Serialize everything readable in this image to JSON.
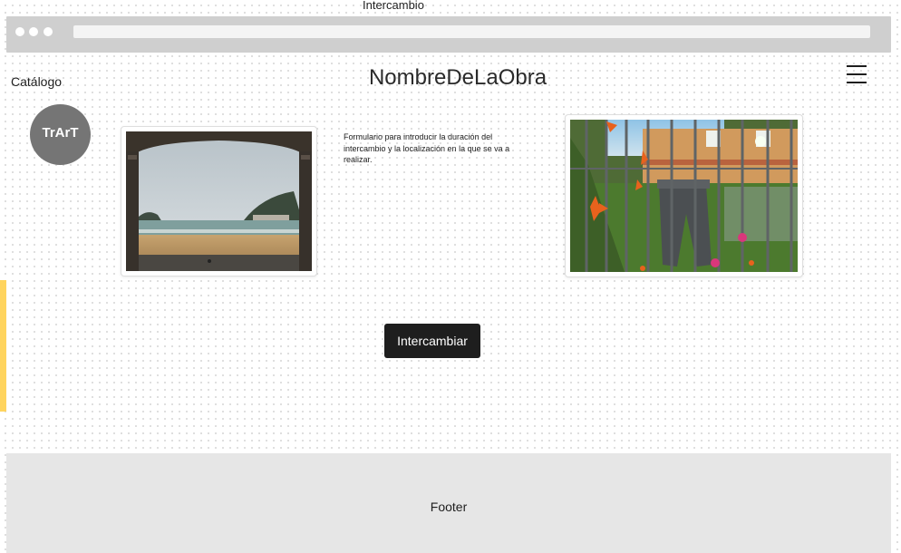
{
  "frame": {
    "title": "Intercambio"
  },
  "browser": {
    "window_controls": [
      "dot-icon",
      "dot-icon",
      "dot-icon"
    ],
    "address_bar_value": ""
  },
  "header": {
    "catalog_link": "Catálogo",
    "artwork_title": "NombreDeLaObra",
    "menu_icon": "hamburger-icon"
  },
  "logo": {
    "text": "TrArT"
  },
  "main": {
    "left_image": {
      "subject": "beach view through stone archway"
    },
    "form_description": "Formulario para introducir la duración del intercambio y la localización en la que se va a realizar.",
    "right_image": {
      "subject": "jeans hanging on a fence with orange lilies"
    },
    "exchange_button": "Intercambiar"
  },
  "footer": {
    "label": "Footer"
  },
  "colors": {
    "button_background": "#1e1e1e",
    "logo_background": "#757575",
    "footer_background": "#e6e6e6",
    "browser_bar": "#cfcfcf",
    "side_tab": "#ffd45e"
  }
}
